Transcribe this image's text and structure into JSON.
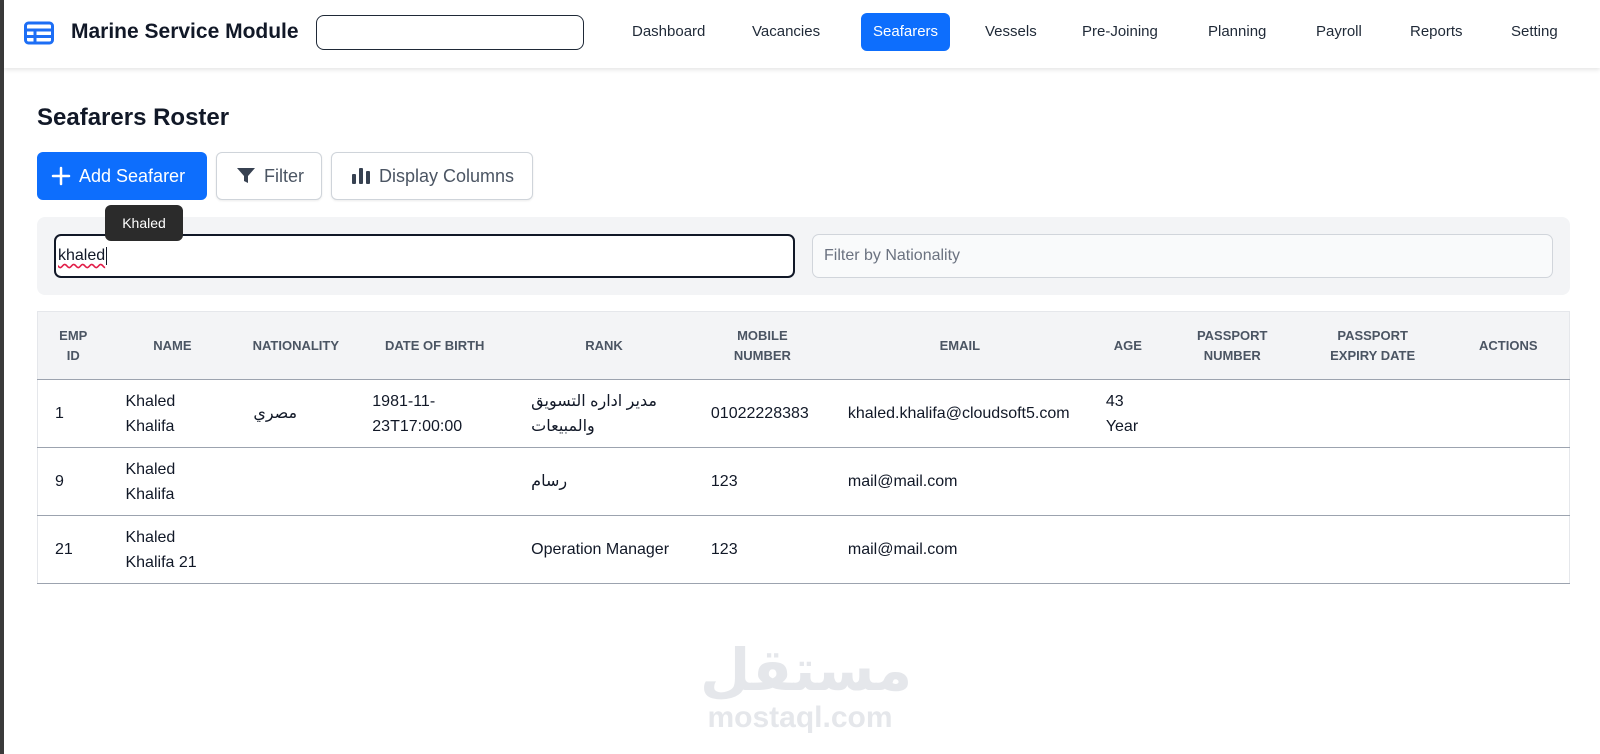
{
  "app": {
    "title": "Marine Service Module",
    "search_value": ""
  },
  "nav": {
    "items": [
      {
        "label": "Dashboard",
        "active": false
      },
      {
        "label": "Vacancies",
        "active": false
      },
      {
        "label": "Seafarers",
        "active": true
      },
      {
        "label": "Vessels",
        "active": false
      },
      {
        "label": "Pre-Joining",
        "active": false
      },
      {
        "label": "Planning",
        "active": false
      },
      {
        "label": "Payroll",
        "active": false
      },
      {
        "label": "Reports",
        "active": false
      },
      {
        "label": "Setting",
        "active": false
      }
    ]
  },
  "page": {
    "title": "Seafarers Roster"
  },
  "toolbar": {
    "add_label": "Add Seafarer",
    "filter_label": "Filter",
    "columns_label": "Display Columns"
  },
  "filters": {
    "name_value": "khaled",
    "name_tooltip": "Khaled",
    "nationality_placeholder": "Filter by Nationality"
  },
  "table": {
    "headers": [
      "Emp ID",
      "Name",
      "Nationality",
      "Date of Birth",
      "Rank",
      "Mobile Number",
      "Email",
      "Age",
      "Passport Number",
      "Passport Expiry Date",
      "Actions"
    ],
    "rows": [
      {
        "emp_id": "1",
        "name": "Khaled Khalifa",
        "nationality": "مصري",
        "dob": "1981-11-23T17:00:00",
        "rank": "مدير اداره التسويق والمبيعات",
        "mobile": "01022228383",
        "email": "khaled.khalifa@cloudsoft5.com",
        "age": "43 Year",
        "passport": "",
        "passport_expiry": "",
        "actions": ""
      },
      {
        "emp_id": "9",
        "name": "Khaled Khalifa",
        "nationality": "",
        "dob": "",
        "rank": "رسام",
        "mobile": "123",
        "email": "mail@mail.com",
        "age": "",
        "passport": "",
        "passport_expiry": "",
        "actions": ""
      },
      {
        "emp_id": "21",
        "name": "Khaled Khalifa 21",
        "nationality": "",
        "dob": "",
        "rank": "Operation Manager",
        "mobile": "123",
        "email": "mail@mail.com",
        "age": "",
        "passport": "",
        "passport_expiry": "",
        "actions": ""
      }
    ]
  },
  "watermark": {
    "arabic": "مستقل",
    "latin": "mostaql.com"
  },
  "colors": {
    "primary": "#0d6efd",
    "text": "#1f2937",
    "panel": "#f3f4f6"
  }
}
